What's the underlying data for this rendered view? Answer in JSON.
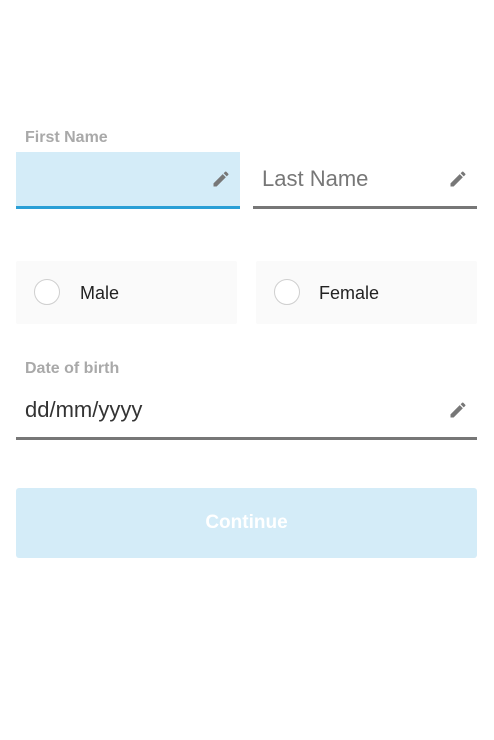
{
  "form": {
    "first_name": {
      "label": "First Name",
      "value": "",
      "placeholder": ""
    },
    "last_name": {
      "label": "",
      "value": "",
      "placeholder": "Last Name"
    },
    "gender": {
      "options": [
        {
          "label": "Male",
          "selected": false
        },
        {
          "label": "Female",
          "selected": false
        }
      ]
    },
    "dob": {
      "label": "Date of birth",
      "value": "",
      "placeholder": "dd/mm/yyyy"
    },
    "continue_label": "Continue"
  },
  "icons": {
    "edit": "pencil-icon"
  },
  "colors": {
    "focus_fill": "#d4ecf8",
    "focus_underline": "#2a9fd6",
    "underline": "#777777",
    "label": "#a9a9a9",
    "button_disabled": "#d4ecf8"
  }
}
